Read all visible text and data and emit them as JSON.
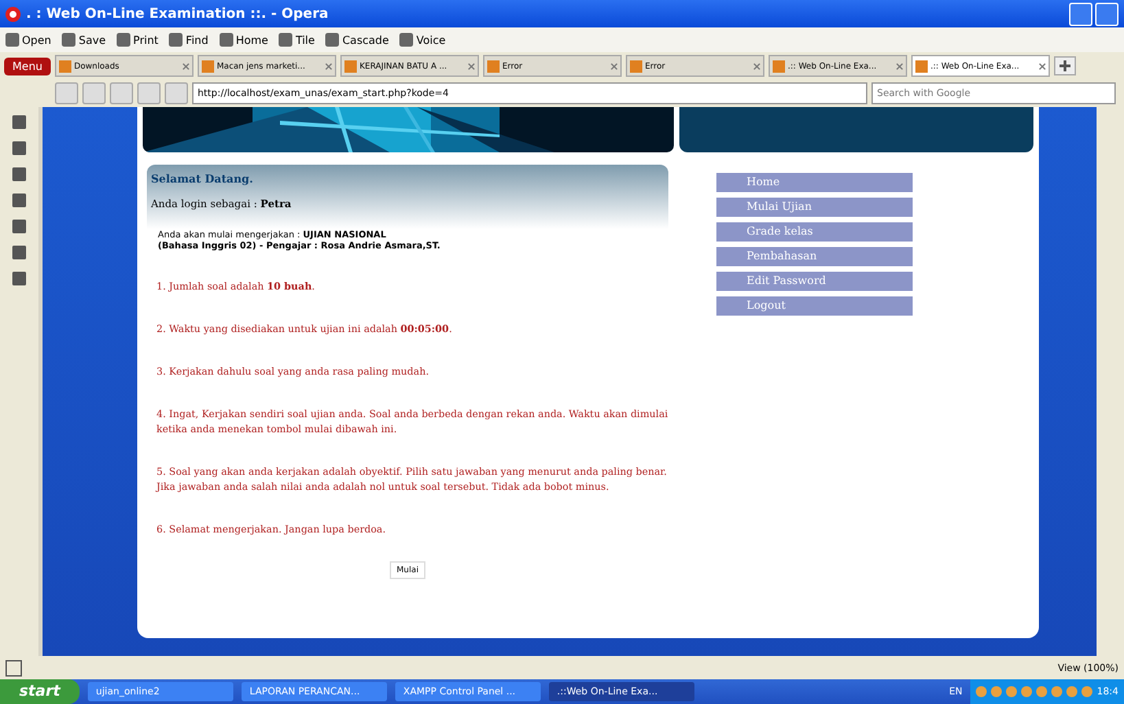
{
  "window": {
    "title": ". : Web On-Line Examination ::. - Opera"
  },
  "toolbar": [
    "Open",
    "Save",
    "Print",
    "Find",
    "Home",
    "Tile",
    "Cascade",
    "Voice"
  ],
  "menu_button": "Menu",
  "tabs": [
    {
      "label": "Downloads",
      "selected": false
    },
    {
      "label": "Macan jens marketi...",
      "selected": false
    },
    {
      "label": "KERAJINAN BATU A ...",
      "selected": false
    },
    {
      "label": "Error",
      "selected": false
    },
    {
      "label": "Error",
      "selected": false
    },
    {
      "label": ".:: Web On-Line Exa...",
      "selected": false
    },
    {
      "label": ".:: Web On-Line Exa...",
      "selected": true
    }
  ],
  "address": {
    "value": "http://localhost/exam_unas/exam_start.php?kode=4"
  },
  "search": {
    "placeholder": "Search with Google"
  },
  "page": {
    "welcome": "Selamat Datang.",
    "login_label": "Anda login sebagai :",
    "login_user": "Petra",
    "intro": "Anda akan mulai mengerjakan : **UJIAN NASIONAL**",
    "intro2": "(Bahasa Inggris 02) - Pengajar : Rosa Andrie Asmara,ST.",
    "rules": [
      "1. Jumlah soal adalah **10 buah**.",
      "2. Waktu yang disediakan untuk ujian ini adalah **00:05:00**.",
      "3. Kerjakan dahulu soal yang anda rasa paling mudah.",
      "4. Ingat, Kerjakan sendiri soal ujian anda. Soal anda berbeda dengan rekan anda. Waktu akan dimulai ketika anda menekan tombol mulai dibawah ini.",
      "5. Soal yang akan anda kerjakan adalah obyektif. Pilih satu jawaban yang menurut anda paling benar. Jika jawaban anda salah nilai anda adalah nol untuk soal tersebut. Tidak ada bobot minus.",
      "6. Selamat mengerjakan. Jangan lupa berdoa."
    ],
    "start_button": "Mulai",
    "menu": [
      "Home",
      "Mulai Ujian",
      "Grade kelas",
      "Pembahasan",
      "Edit Password",
      "Logout"
    ]
  },
  "status_bar": {
    "zoom": "View (100%)"
  },
  "taskbar": {
    "start": "start",
    "tasks": [
      {
        "label": "ujian_online2",
        "selected": false
      },
      {
        "label": "LAPORAN PERANCAN...",
        "selected": false
      },
      {
        "label": "XAMPP Control Panel ...",
        "selected": false
      },
      {
        "label": ".::Web On-Line Exa...",
        "selected": true
      }
    ],
    "lang": "EN",
    "clock": "18:4"
  }
}
